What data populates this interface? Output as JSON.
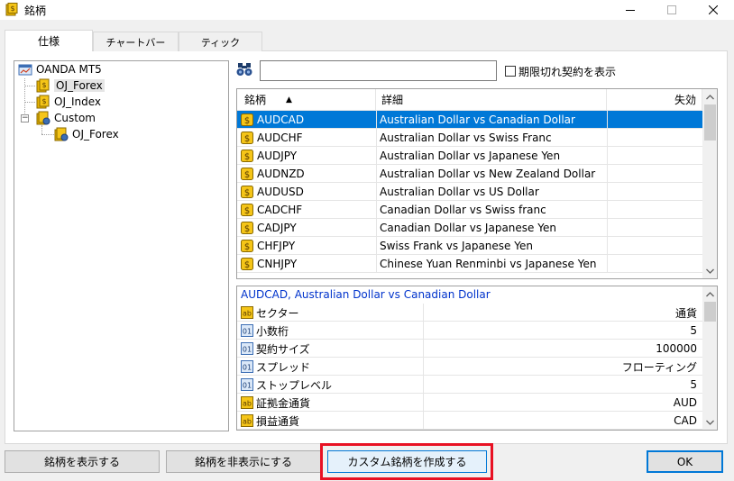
{
  "window": {
    "title": "銘柄"
  },
  "tabs": [
    {
      "label": "仕様"
    },
    {
      "label": "チャートバー"
    },
    {
      "label": "ティック"
    }
  ],
  "tree": {
    "root": "OANDA MT5",
    "items": [
      "OJ_Forex",
      "OJ_Index",
      "Custom"
    ],
    "custom_children": [
      "OJ_Forex"
    ]
  },
  "search": {
    "value": "",
    "placeholder": ""
  },
  "show_expired": {
    "label": "期限切れ契約を表示",
    "checked": false
  },
  "symbol_table": {
    "columns": [
      "銘柄",
      "詳細",
      "失効"
    ],
    "sort_indicator": "▲",
    "rows": [
      {
        "symbol": "AUDCAD",
        "description": "Australian Dollar vs Canadian Dollar",
        "expiry": ""
      },
      {
        "symbol": "AUDCHF",
        "description": "Australian Dollar vs Swiss Franc",
        "expiry": ""
      },
      {
        "symbol": "AUDJPY",
        "description": "Australian Dollar vs Japanese Yen",
        "expiry": ""
      },
      {
        "symbol": "AUDNZD",
        "description": "Australian Dollar vs New Zealand Dollar",
        "expiry": ""
      },
      {
        "symbol": "AUDUSD",
        "description": "Australian Dollar vs US Dollar",
        "expiry": ""
      },
      {
        "symbol": "CADCHF",
        "description": "Canadian Dollar vs Swiss franc",
        "expiry": ""
      },
      {
        "symbol": "CADJPY",
        "description": "Canadian Dollar vs Japanese Yen",
        "expiry": ""
      },
      {
        "symbol": "CHFJPY",
        "description": "Swiss Frank vs Japanese Yen",
        "expiry": ""
      },
      {
        "symbol": "CNHJPY",
        "description": "Chinese Yuan Renminbi vs Japanese Yen",
        "expiry": ""
      }
    ],
    "selected_index": 0
  },
  "properties": {
    "header": "AUDCAD, Australian Dollar vs Canadian Dollar",
    "rows": [
      {
        "icon": "ab",
        "name": "セクター",
        "value": "通貨"
      },
      {
        "icon": "01",
        "name": "小数桁",
        "value": "5"
      },
      {
        "icon": "01",
        "name": "契約サイズ",
        "value": "100000"
      },
      {
        "icon": "01",
        "name": "スプレッド",
        "value": "フローティング"
      },
      {
        "icon": "01",
        "name": "ストップレベル",
        "value": "5"
      },
      {
        "icon": "ab",
        "name": "証拠金通貨",
        "value": "AUD"
      },
      {
        "icon": "ab",
        "name": "損益通貨",
        "value": "CAD"
      }
    ]
  },
  "buttons": {
    "show": "銘柄を表示する",
    "hide": "銘柄を非表示にする",
    "create_custom": "カスタム銘柄を作成する",
    "ok": "OK"
  },
  "colors": {
    "selection": "#0078d7",
    "highlight": "#e81123",
    "link_blue": "#0033cc",
    "icon_gold": "#e8b400"
  }
}
